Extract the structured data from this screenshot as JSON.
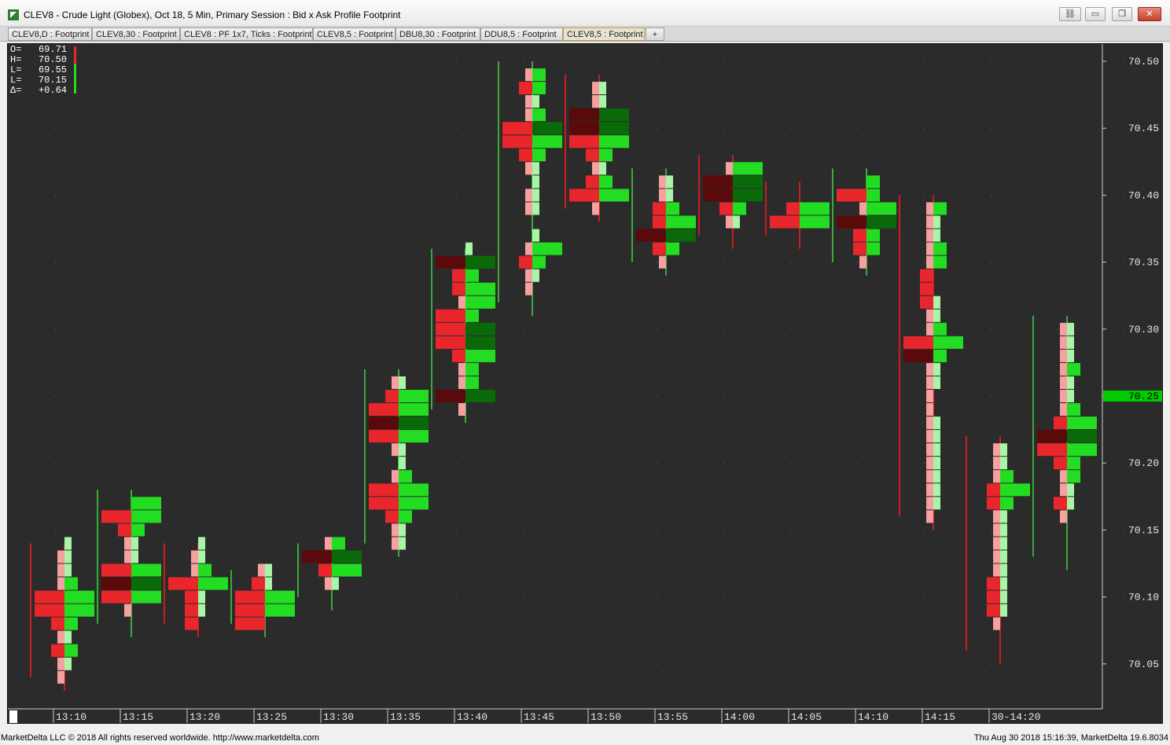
{
  "window": {
    "title": "CLEV8 - Crude Light (Globex), Oct 18, 5 Min, Primary Session : Bid x Ask Profile Footprint",
    "buttons": {
      "minimize": "▭",
      "restore": "❐",
      "close": "✕"
    }
  },
  "tabs": [
    "CLEV8,D : Footprint",
    "CLEV8,30 : Footprint",
    "CLEV8 : PF 1x7, Ticks : Footprint",
    "CLEV8,5 : Footprint",
    "DBU8,30 : Footprint",
    "DDU8,5 : Footprint",
    "CLEV8,5 : Footprint",
    "+"
  ],
  "active_tab_index": 6,
  "ohlc": [
    {
      "label": "O=",
      "value": "69.71"
    },
    {
      "label": "H=",
      "value": "70.50"
    },
    {
      "label": "L=",
      "value": "69.55"
    },
    {
      "label": "L=",
      "value": "70.15"
    },
    {
      "label": "Δ=",
      "value": "+0.64"
    }
  ],
  "status": {
    "left": "MarketDelta LLC © 2018 All rights reserved worldwide. http://www.marketdelta.com",
    "right": "Thu Aug 30 2018 15:16:39, MarketDelta 19.6.8034"
  },
  "colors": {
    "background": "#2b2b2b",
    "bid_strong": "#e8262b",
    "bid_light": "#f6a0a0",
    "bid_dark": "#5a0a0a",
    "ask_strong": "#22dd22",
    "ask_light": "#a8f5a8",
    "ask_dark": "#0a6a0a",
    "last_price": "#00cc00"
  },
  "chart_data": {
    "type": "footprint",
    "instrument": "CLEV8",
    "y_ticks": [
      "70.50",
      "70.45",
      "70.40",
      "70.35",
      "70.30",
      "70.25",
      "70.20",
      "70.15",
      "70.10",
      "70.05"
    ],
    "ylim": [
      70.03,
      70.52
    ],
    "last_price": "70.25",
    "x_ticks": [
      "13:10",
      "13:15",
      "13:20",
      "13:25",
      "13:30",
      "13:35",
      "13:40",
      "13:45",
      "13:50",
      "13:55",
      "14:00",
      "14:05",
      "14:10",
      "14:15",
      "30-14:20"
    ],
    "bars": [
      {
        "time": "13:05",
        "low": 70.03,
        "high": 70.11,
        "dir": "up",
        "profile": []
      },
      {
        "time": "13:10",
        "low": 70.04,
        "high": 70.14,
        "dir": "dn",
        "profile": [
          [
            70.14,
            0,
            1
          ],
          [
            70.13,
            1,
            1
          ],
          [
            70.12,
            1,
            1
          ],
          [
            70.11,
            1,
            2
          ],
          [
            70.1,
            3,
            3
          ],
          [
            70.09,
            3,
            3
          ],
          [
            70.08,
            2,
            2
          ],
          [
            70.07,
            1,
            1
          ],
          [
            70.06,
            2,
            2
          ],
          [
            70.05,
            1,
            1
          ],
          [
            70.04,
            1,
            0
          ]
        ]
      },
      {
        "time": "13:15",
        "low": 70.08,
        "high": 70.18,
        "dir": "up",
        "profile": [
          [
            70.18,
            0,
            0
          ],
          [
            70.17,
            0,
            3
          ],
          [
            70.16,
            3,
            3
          ],
          [
            70.15,
            2,
            2
          ],
          [
            70.14,
            1,
            1
          ],
          [
            70.13,
            1,
            1
          ],
          [
            70.12,
            3,
            3
          ],
          [
            70.11,
            4,
            4
          ],
          [
            70.1,
            3,
            3
          ],
          [
            70.09,
            1,
            0
          ]
        ]
      },
      {
        "time": "13:20",
        "low": 70.08,
        "high": 70.14,
        "dir": "dn",
        "profile": [
          [
            70.14,
            0,
            1
          ],
          [
            70.13,
            1,
            1
          ],
          [
            70.12,
            1,
            2
          ],
          [
            70.11,
            3,
            3
          ],
          [
            70.1,
            2,
            1
          ],
          [
            70.09,
            2,
            1
          ],
          [
            70.08,
            2,
            0
          ]
        ]
      },
      {
        "time": "13:25",
        "low": 70.08,
        "high": 70.12,
        "dir": "up",
        "profile": [
          [
            70.12,
            1,
            1
          ],
          [
            70.11,
            2,
            1
          ],
          [
            70.1,
            3,
            3
          ],
          [
            70.09,
            3,
            3
          ],
          [
            70.08,
            3,
            0
          ]
        ]
      },
      {
        "time": "13:30",
        "low": 70.1,
        "high": 70.14,
        "dir": "up",
        "profile": [
          [
            70.14,
            1,
            2
          ],
          [
            70.13,
            4,
            4
          ],
          [
            70.12,
            2,
            3
          ],
          [
            70.11,
            1,
            1
          ],
          [
            70.1,
            0,
            0
          ]
        ]
      },
      {
        "time": "13:35",
        "low": 70.14,
        "high": 70.27,
        "dir": "up",
        "profile": [
          [
            70.27,
            0,
            0
          ],
          [
            70.26,
            1,
            1
          ],
          [
            70.25,
            2,
            3
          ],
          [
            70.24,
            3,
            3
          ],
          [
            70.23,
            4,
            4
          ],
          [
            70.22,
            3,
            3
          ],
          [
            70.21,
            1,
            1
          ],
          [
            70.2,
            0,
            1
          ],
          [
            70.19,
            1,
            2
          ],
          [
            70.18,
            3,
            3
          ],
          [
            70.17,
            3,
            3
          ],
          [
            70.16,
            2,
            2
          ],
          [
            70.15,
            1,
            1
          ],
          [
            70.14,
            1,
            1
          ]
        ]
      },
      {
        "time": "13:40",
        "low": 70.24,
        "high": 70.36,
        "dir": "up",
        "profile": [
          [
            70.36,
            0,
            1
          ],
          [
            70.35,
            4,
            4
          ],
          [
            70.34,
            2,
            2
          ],
          [
            70.33,
            2,
            3
          ],
          [
            70.32,
            1,
            3
          ],
          [
            70.31,
            3,
            2
          ],
          [
            70.3,
            3,
            4
          ],
          [
            70.29,
            3,
            4
          ],
          [
            70.28,
            2,
            3
          ],
          [
            70.27,
            1,
            2
          ],
          [
            70.26,
            1,
            2
          ],
          [
            70.25,
            4,
            4
          ],
          [
            70.24,
            1,
            0
          ]
        ]
      },
      {
        "time": "13:45",
        "low": 70.32,
        "high": 70.5,
        "dir": "up",
        "profile": [
          [
            70.5,
            0,
            0
          ],
          [
            70.49,
            1,
            2
          ],
          [
            70.48,
            2,
            2
          ],
          [
            70.47,
            1,
            1
          ],
          [
            70.46,
            1,
            2
          ],
          [
            70.45,
            3,
            4
          ],
          [
            70.44,
            3,
            3
          ],
          [
            70.43,
            2,
            2
          ],
          [
            70.42,
            1,
            1
          ],
          [
            70.41,
            0,
            1
          ],
          [
            70.4,
            1,
            1
          ],
          [
            70.39,
            1,
            1
          ],
          [
            70.38,
            0,
            0
          ],
          [
            70.37,
            0,
            1
          ],
          [
            70.36,
            1,
            3
          ],
          [
            70.35,
            2,
            2
          ],
          [
            70.34,
            1,
            1
          ],
          [
            70.33,
            1,
            0
          ],
          [
            70.32,
            0,
            0
          ]
        ]
      },
      {
        "time": "13:50",
        "low": 70.39,
        "high": 70.49,
        "dir": "dn",
        "profile": [
          [
            70.49,
            0,
            0
          ],
          [
            70.48,
            1,
            1
          ],
          [
            70.47,
            1,
            1
          ],
          [
            70.46,
            4,
            4
          ],
          [
            70.45,
            4,
            4
          ],
          [
            70.44,
            3,
            3
          ],
          [
            70.43,
            2,
            2
          ],
          [
            70.42,
            1,
            1
          ],
          [
            70.41,
            2,
            2
          ],
          [
            70.4,
            3,
            3
          ],
          [
            70.39,
            1,
            0
          ]
        ]
      },
      {
        "time": "13:55",
        "low": 70.35,
        "high": 70.42,
        "dir": "up",
        "profile": [
          [
            70.42,
            0,
            0
          ],
          [
            70.41,
            1,
            1
          ],
          [
            70.4,
            1,
            1
          ],
          [
            70.39,
            2,
            2
          ],
          [
            70.38,
            2,
            3
          ],
          [
            70.37,
            4,
            4
          ],
          [
            70.36,
            2,
            2
          ],
          [
            70.35,
            1,
            0
          ]
        ]
      },
      {
        "time": "14:00",
        "low": 70.37,
        "high": 70.43,
        "dir": "dn",
        "profile": [
          [
            70.43,
            0,
            0
          ],
          [
            70.42,
            1,
            3
          ],
          [
            70.41,
            4,
            4
          ],
          [
            70.4,
            4,
            4
          ],
          [
            70.39,
            2,
            2
          ],
          [
            70.38,
            1,
            1
          ],
          [
            70.37,
            0,
            0
          ]
        ]
      },
      {
        "time": "14:05",
        "low": 70.37,
        "high": 70.41,
        "dir": "dn",
        "profile": [
          [
            70.41,
            0,
            0
          ],
          [
            70.4,
            0,
            0
          ],
          [
            70.39,
            2,
            3
          ],
          [
            70.38,
            3,
            3
          ],
          [
            70.37,
            0,
            0
          ]
        ]
      },
      {
        "time": "14:10",
        "low": 70.35,
        "high": 70.42,
        "dir": "up",
        "profile": [
          [
            70.42,
            0,
            0
          ],
          [
            70.41,
            0,
            2
          ],
          [
            70.4,
            3,
            2
          ],
          [
            70.39,
            1,
            3
          ],
          [
            70.38,
            4,
            4
          ],
          [
            70.37,
            2,
            2
          ],
          [
            70.36,
            2,
            2
          ],
          [
            70.35,
            1,
            0
          ]
        ]
      },
      {
        "time": "14:15",
        "low": 70.16,
        "high": 70.4,
        "dir": "dn",
        "profile": [
          [
            70.4,
            0,
            0
          ],
          [
            70.39,
            1,
            2
          ],
          [
            70.38,
            1,
            1
          ],
          [
            70.37,
            1,
            1
          ],
          [
            70.36,
            1,
            2
          ],
          [
            70.35,
            1,
            2
          ],
          [
            70.34,
            2,
            0
          ],
          [
            70.33,
            2,
            0
          ],
          [
            70.32,
            2,
            1
          ],
          [
            70.31,
            1,
            1
          ],
          [
            70.3,
            1,
            2
          ],
          [
            70.29,
            3,
            3
          ],
          [
            70.28,
            4,
            2
          ],
          [
            70.27,
            1,
            1
          ],
          [
            70.26,
            1,
            1
          ],
          [
            70.25,
            1,
            0
          ],
          [
            70.24,
            1,
            0
          ],
          [
            70.23,
            1,
            1
          ],
          [
            70.22,
            1,
            1
          ],
          [
            70.21,
            1,
            1
          ],
          [
            70.2,
            1,
            1
          ],
          [
            70.19,
            1,
            1
          ],
          [
            70.18,
            1,
            1
          ],
          [
            70.17,
            1,
            1
          ],
          [
            70.16,
            1,
            0
          ]
        ]
      },
      {
        "time": "14:20",
        "low": 70.06,
        "high": 70.22,
        "dir": "dn",
        "profile": [
          [
            70.22,
            0,
            0
          ],
          [
            70.21,
            1,
            1
          ],
          [
            70.2,
            1,
            1
          ],
          [
            70.19,
            1,
            2
          ],
          [
            70.18,
            2,
            3
          ],
          [
            70.17,
            2,
            2
          ],
          [
            70.16,
            1,
            1
          ],
          [
            70.15,
            1,
            1
          ],
          [
            70.14,
            1,
            1
          ],
          [
            70.13,
            1,
            1
          ],
          [
            70.12,
            1,
            1
          ],
          [
            70.11,
            2,
            1
          ],
          [
            70.1,
            2,
            1
          ],
          [
            70.09,
            2,
            1
          ],
          [
            70.08,
            1,
            0
          ],
          [
            70.07,
            0,
            0
          ],
          [
            70.06,
            0,
            0
          ]
        ]
      },
      {
        "time": "14:25",
        "low": 70.13,
        "high": 70.31,
        "dir": "up",
        "profile": [
          [
            70.31,
            0,
            0
          ],
          [
            70.3,
            1,
            1
          ],
          [
            70.29,
            1,
            1
          ],
          [
            70.28,
            1,
            1
          ],
          [
            70.27,
            1,
            2
          ],
          [
            70.26,
            1,
            1
          ],
          [
            70.25,
            1,
            1
          ],
          [
            70.24,
            1,
            2
          ],
          [
            70.23,
            2,
            3
          ],
          [
            70.22,
            4,
            4
          ],
          [
            70.21,
            3,
            3
          ],
          [
            70.2,
            2,
            2
          ],
          [
            70.19,
            1,
            2
          ],
          [
            70.18,
            1,
            1
          ],
          [
            70.17,
            2,
            1
          ],
          [
            70.16,
            1,
            0
          ],
          [
            70.15,
            0,
            0
          ],
          [
            70.14,
            0,
            0
          ]
        ]
      }
    ]
  }
}
